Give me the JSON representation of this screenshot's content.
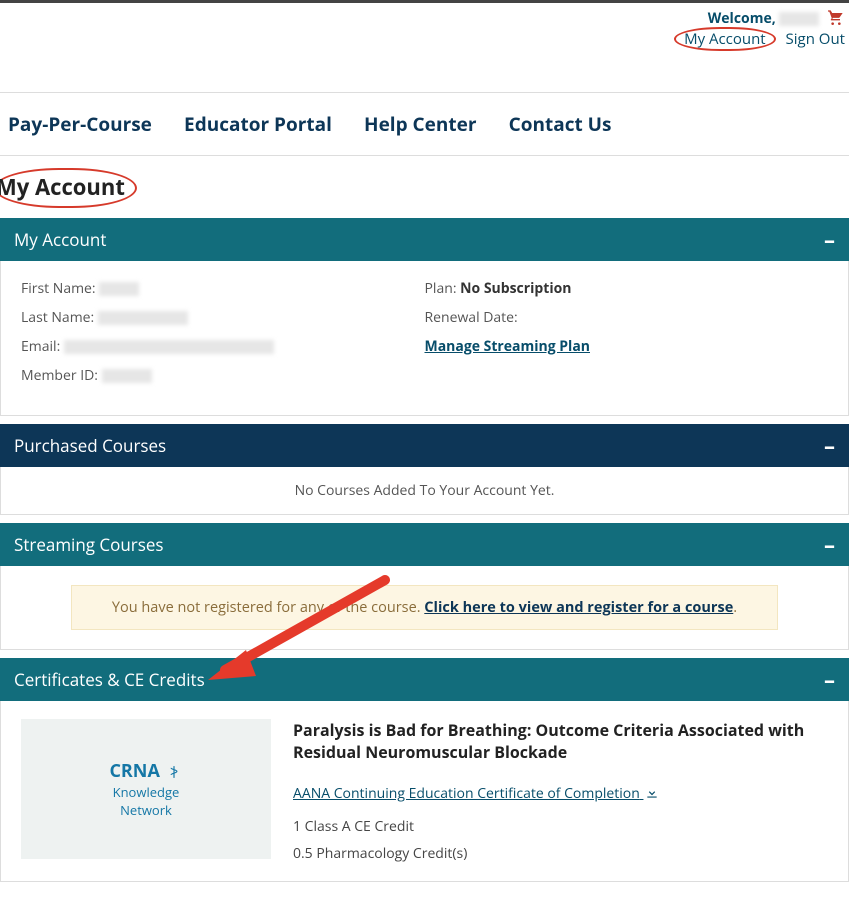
{
  "top": {
    "welcome": "Welcome,",
    "my_account": "My Account",
    "sign_out": "Sign Out"
  },
  "nav": {
    "ppc": "Pay-Per-Course",
    "edu": "Educator Portal",
    "help": "Help Center",
    "contact": "Contact Us"
  },
  "page_title": "My Account",
  "panels": {
    "account": {
      "title": "My Account",
      "first_name_label": "First Name:",
      "last_name_label": "Last Name:",
      "email_label": "Email:",
      "member_id_label": "Member ID:",
      "plan_label": "Plan:",
      "plan_value": "No Subscription",
      "renewal_label": "Renewal Date:",
      "manage_link": "Manage Streaming Plan"
    },
    "purchased": {
      "title": "Purchased Courses",
      "empty": "No Courses Added To Your Account Yet."
    },
    "streaming": {
      "title": "Streaming Courses",
      "notice_text": "You have not registered for any of the course. ",
      "notice_link": "Click here to view and register for a course"
    },
    "certs": {
      "title": "Certificates & CE Credits",
      "thumb_line1": "CRNA",
      "thumb_line2": "Knowledge",
      "thumb_line3": "Network",
      "course_title": "Paralysis is Bad for Breathing: Outcome Criteria Associated with Residual Neuromuscular Blockade",
      "cert_link": "AANA Continuing Education Certificate of Completion",
      "credit_a": "1 Class A CE Credit",
      "credit_b": "0.5 Pharmacology Credit(s)"
    }
  }
}
